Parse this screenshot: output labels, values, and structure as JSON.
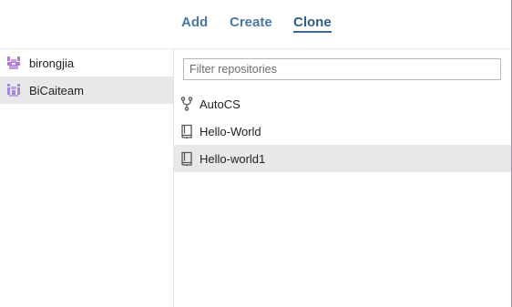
{
  "tabs": [
    {
      "label": "Add",
      "active": false
    },
    {
      "label": "Create",
      "active": false
    },
    {
      "label": "Clone",
      "active": true
    }
  ],
  "accounts": [
    {
      "name": "birongjia",
      "selected": false,
      "avatar_icon": "user-avatar-icon",
      "avatar_color": "#b27ad6"
    },
    {
      "name": "BiCaiteam",
      "selected": true,
      "avatar_icon": "org-avatar-icon",
      "avatar_color": "#a28ad8"
    }
  ],
  "filter": {
    "placeholder": "Filter repositories",
    "value": ""
  },
  "repositories": [
    {
      "name": "AutoCS",
      "icon": "fork-icon",
      "selected": false
    },
    {
      "name": "Hello-World",
      "icon": "repo-book-icon",
      "selected": false
    },
    {
      "name": "Hello-world1",
      "icon": "repo-book-icon",
      "selected": true
    }
  ],
  "colors": {
    "tab": "#4a78a6",
    "selection": "#e8e8e8",
    "accent": "#a58ad1"
  }
}
